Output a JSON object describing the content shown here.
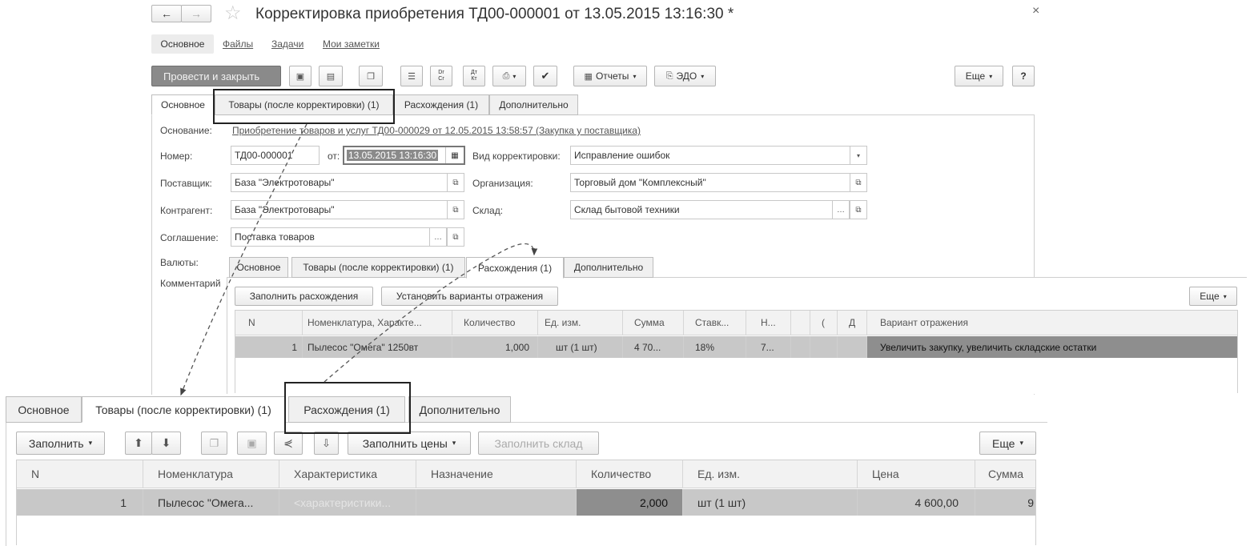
{
  "window": {
    "title": "Корректировка приобретения ТД00-000001 от 13.05.2015 13:16:30 *",
    "close": "×",
    "nav_back": "←",
    "nav_forward": "→",
    "star": "☆"
  },
  "section_nav": [
    "Основное",
    "Файлы",
    "Задачи",
    "Мои заметки"
  ],
  "toolbar": {
    "post_close": "Провести и закрыть",
    "reports": "Отчеты",
    "edo": "ЭДО",
    "more": "Еще",
    "help": "?",
    "dt_cr_label_top": "Dr",
    "dt_cr_label_bottom": "Cr",
    "dt_kt_label_top": "Дт",
    "dt_kt_label_bottom": "Кт"
  },
  "main_tabs": [
    "Основное",
    "Товары (после корректировки) (1)",
    "Расхождения (1)",
    "Дополнительно"
  ],
  "form": {
    "basis_label": "Основание:",
    "basis_link": "Приобретение товаров и услуг ТД00-000029 от 12.05.2015 13:58:57 (Закупка у поставщика)",
    "number_label": "Номер:",
    "number_value": "ТД00-000001",
    "from_label": "от:",
    "date_value": "13.05.2015 13:16:30",
    "corr_type_label": "Вид корректировки:",
    "corr_type_value": "Исправление ошибок",
    "supplier_label": "Поставщик:",
    "supplier_value": "База \"Электротовары\"",
    "org_label": "Организация:",
    "org_value": "Торговый дом \"Комплексный\"",
    "counterparty_label": "Контрагент:",
    "counterparty_value": "База \"Электротовары\"",
    "warehouse_label": "Склад:",
    "warehouse_value": "Склад бытовой техники",
    "agreement_label": "Соглашение:",
    "agreement_value": "Поставка товаров",
    "currency_label": "Валюты:",
    "comment_label": "Комментарий"
  },
  "disc_panel": {
    "tabs": [
      "Основное",
      "Товары (после корректировки) (1)",
      "Расхождения (1)",
      "Дополнительно"
    ],
    "fill_btn": "Заполнить расхождения",
    "variants_btn": "Установить варианты отражения",
    "more": "Еще",
    "columns": [
      "N",
      "Номенклатура, Характе...",
      "Количество",
      "Ед. изм.",
      "Сумма",
      "Ставк...",
      "Н...",
      "",
      "(",
      "Д",
      "Вариант отражения"
    ],
    "row": [
      "1",
      "Пылесос \"Омега\" 1250вт",
      "1,000",
      "шт (1 шт)",
      "4 70...",
      "18%",
      "7...",
      "",
      "",
      "",
      "Увеличить закупку, увеличить складские остатки"
    ]
  },
  "goods_panel": {
    "tabs": [
      "Основное",
      "Товары (после корректировки) (1)",
      "Расхождения (1)",
      "Дополнительно"
    ],
    "fill_btn": "Заполнить",
    "fill_prices_btn": "Заполнить цены",
    "fill_warehouse_btn": "Заполнить склад",
    "more": "Еще",
    "columns": [
      "N",
      "Номенклатура",
      "Характеристика",
      "Назначение",
      "Количество",
      "Ед. изм.",
      "Цена",
      "Сумма"
    ],
    "row": [
      "1",
      "Пылесос \"Омега...",
      "<характеристики...",
      "",
      "2,000",
      "шт (1 шт)",
      "4 600,00",
      "9"
    ]
  },
  "colors": {
    "selected_row": "#c8c8c8",
    "selected_cell": "#8e8e8e",
    "primary_button": "#8a8a8a"
  }
}
